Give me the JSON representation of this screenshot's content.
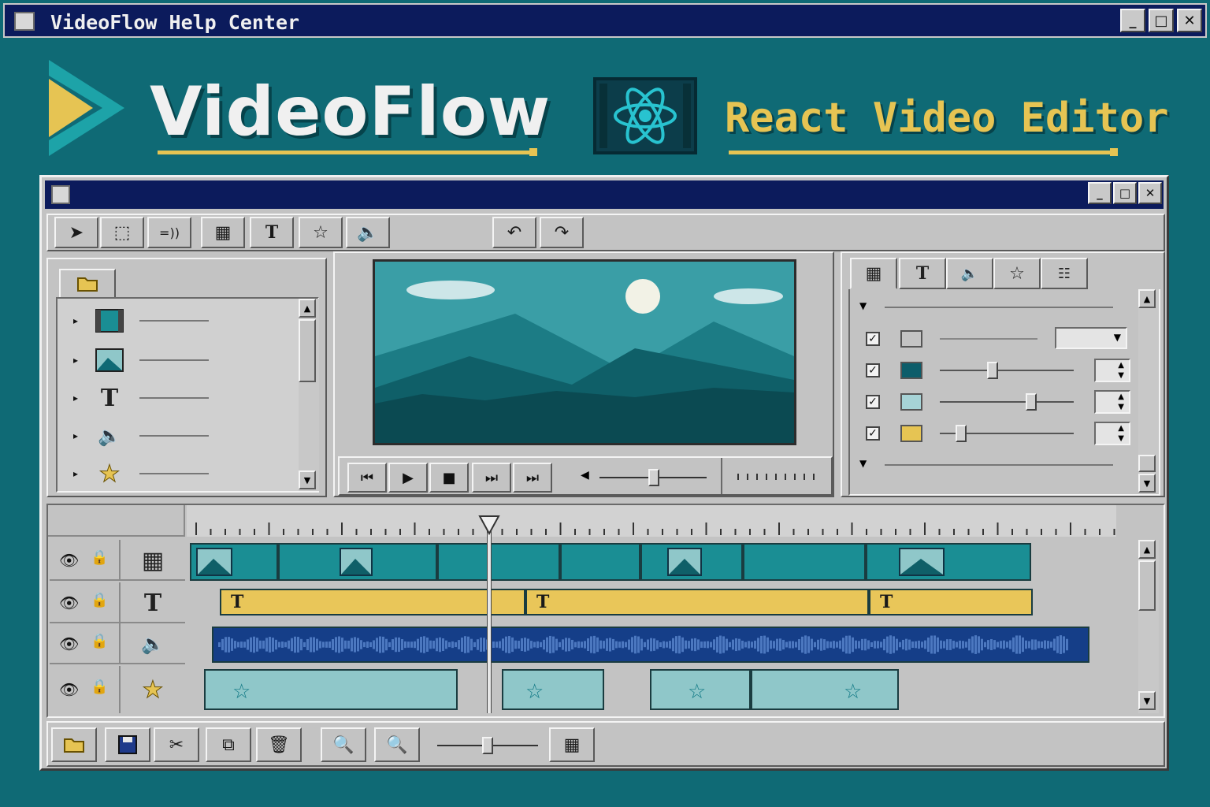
{
  "window": {
    "title": "VideoFlow Help Center",
    "controls": [
      "_",
      "□",
      "✕"
    ]
  },
  "banner": {
    "brand": "VideoFlow",
    "subtitle": "React Video Editor"
  },
  "colors": {
    "background": "#0f6a75",
    "titlebar": "#0c1b5c",
    "accent": "#e6c453",
    "teal": "#1a8e94",
    "audio": "#153e88",
    "fx": "#8fc7c9"
  },
  "toolbar": {
    "tools": [
      "select-arrow-icon",
      "marquee-select-icon",
      "audio-tool-icon",
      "film-icon",
      "text-icon",
      "star-icon",
      "speaker-icon"
    ],
    "history": [
      "undo-icon",
      "redo-icon"
    ]
  },
  "media_panel": {
    "items": [
      "film-icon",
      "image-icon",
      "text-icon",
      "speaker-icon",
      "star-icon"
    ]
  },
  "properties": {
    "tabs": [
      "film-icon",
      "text-icon",
      "speaker-icon",
      "star-icon",
      "layout-icon"
    ],
    "rows": [
      {
        "checked": true,
        "color": "#c4c4c4",
        "control": "dropdown"
      },
      {
        "checked": true,
        "color": "#0d5d6a",
        "level": 0.38
      },
      {
        "checked": true,
        "color": "#a6d3d6",
        "level": 0.67
      },
      {
        "checked": true,
        "color": "#e6c453",
        "level": 0.14
      }
    ]
  },
  "transport": {
    "buttons": [
      "skip-back-icon",
      "play-icon",
      "stop-icon",
      "step-forward-icon",
      "skip-end-icon"
    ],
    "volume_level": 0.5
  },
  "timeline": {
    "tracks": [
      "video",
      "text",
      "audio",
      "effects"
    ],
    "text_clip_labels": [
      "T",
      "T",
      "T"
    ]
  },
  "bottom_bar": {
    "buttons": [
      "open-folder-icon",
      "save-icon",
      "cut-icon",
      "copy-icon",
      "delete-icon",
      "zoom-out-icon",
      "zoom-in-icon",
      "grid-icon"
    ],
    "zoom_level": 0.5
  }
}
